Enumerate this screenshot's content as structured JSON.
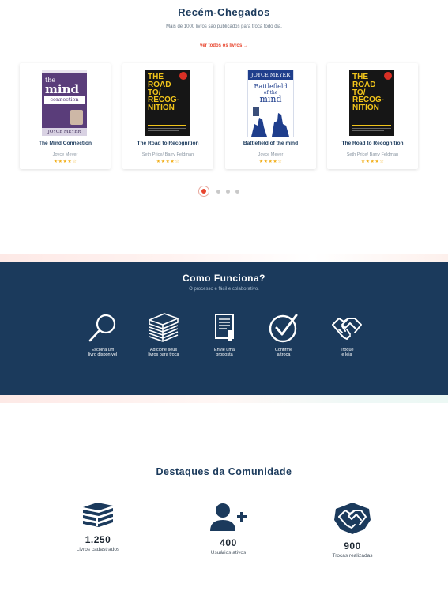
{
  "new_arrivals": {
    "title": "Recém-Chegados",
    "subtitle": "Mais de 1000 livros são publicados para troca todo dia.",
    "see_all": "ver todos os livros →",
    "books": [
      {
        "title": "The Mind Connection",
        "author": "Joyce Meyer",
        "stars": "★★★★☆",
        "cover_top": "the",
        "cover_mid": "mind",
        "cover_sub": "connection",
        "cover_bottom": "JOYCE MEYER",
        "cover_bg": "#5a3d7a"
      },
      {
        "title": "The Road to Recognition",
        "author": "Seth Price/ Barry Feldman",
        "stars": "★★★★☆",
        "cover_lines": [
          "THE",
          "ROAD",
          "TO/",
          "RECOG-",
          "NITION"
        ],
        "cover_bg": "#1a1a1a",
        "cover_accent": "#f2c51b"
      },
      {
        "title": "Battlefield of the mind",
        "author": "Joyce Meyer",
        "stars": "★★★★☆",
        "cover_top": "JOYCE MEYER",
        "cover_mid": "Battlefield",
        "cover_sub": "of the",
        "cover_word": "mind",
        "cover_bg": "#ffffff",
        "cover_accent": "#1f3e8c"
      },
      {
        "title": "The Road to Recognition",
        "author": "Seth Price/ Barry Feldman",
        "stars": "★★★★☆",
        "cover_lines": [
          "THE",
          "ROAD",
          "TO/",
          "RECOG-",
          "NITION"
        ],
        "cover_bg": "#1a1a1a",
        "cover_accent": "#f2c51b"
      }
    ],
    "pagination": {
      "count": 4,
      "active": 1
    }
  },
  "how_it_works": {
    "title": "Como Funciona?",
    "subtitle": "O processo é fácil e colaborativo.",
    "steps": [
      {
        "icon": "magnifier-icon",
        "line1": "Escolha um",
        "line2": "livro disponível"
      },
      {
        "icon": "book-stack-icon",
        "line1": "Adicione seus",
        "line2": "livros para troca"
      },
      {
        "icon": "document-pen-icon",
        "line1": "Envie uma",
        "line2": "proposta"
      },
      {
        "icon": "check-circle-icon",
        "line1": "Confirme",
        "line2": "a troca"
      },
      {
        "icon": "handshake-icon",
        "line1": "Troque",
        "line2": "e leia"
      }
    ]
  },
  "community": {
    "title": "Destaques da Comunidade",
    "stats": [
      {
        "icon": "books-icon",
        "value": "1.250",
        "label": "Livros cadastrados"
      },
      {
        "icon": "add-user-icon",
        "value": "400",
        "label": "Usuários ativos"
      },
      {
        "icon": "handshake-badge-icon",
        "value": "900",
        "label": "Trocas realizadas"
      }
    ]
  },
  "colors": {
    "navy": "#1b3a5c",
    "accent": "#e8462f",
    "star": "#f2b01e"
  }
}
